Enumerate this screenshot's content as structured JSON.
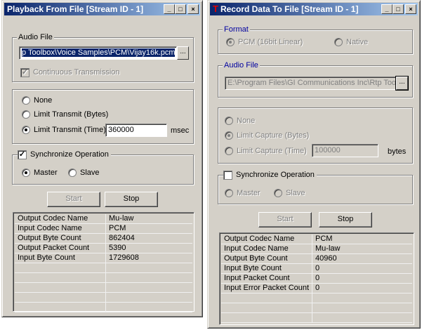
{
  "playback": {
    "title": "Playback From File [Stream ID - 1]",
    "audio_file_legend": "Audio File",
    "file_path": "p Toolbox\\Voice Samples\\PCM\\Vijay16k.pcm",
    "browse_label": "...",
    "continuous_label": "Continuous Transmission",
    "limit_none": "None",
    "limit_bytes": "Limit Transmit (Bytes)",
    "limit_time": "Limit Transmit (Time)",
    "limit_value": "360000",
    "limit_unit": "msec",
    "sync_label": "Synchronize Operation",
    "master_label": "Master",
    "slave_label": "Slave",
    "start_label": "Start",
    "stop_label": "Stop",
    "rows": [
      {
        "name": "Output Codec Name",
        "value": "Mu-law"
      },
      {
        "name": "Input Codec Name",
        "value": "PCM"
      },
      {
        "name": "Output Byte Count",
        "value": "862404"
      },
      {
        "name": "Output Packet Count",
        "value": "5390"
      },
      {
        "name": "Input Byte Count",
        "value": "1729608"
      },
      {
        "name": "",
        "value": ""
      },
      {
        "name": "",
        "value": ""
      },
      {
        "name": "",
        "value": ""
      },
      {
        "name": "",
        "value": ""
      },
      {
        "name": "",
        "value": ""
      }
    ]
  },
  "record": {
    "title_icon": "T",
    "title": "Record Data To File [Stream ID - 1]",
    "format_legend": "Format",
    "pcm_label": "PCM (16bit Linear)",
    "native_label": "Native",
    "audio_file_legend": "Audio File",
    "file_path": "E:\\Program Files\\GI Communications Inc\\Rtp Too",
    "browse_label": "...",
    "limit_none": "None",
    "limit_bytes": "Limit Capture (Bytes)",
    "limit_time": "Limit Capture (Time)",
    "limit_value": "100000",
    "limit_unit": "bytes",
    "sync_label": "Synchronize Operation",
    "master_label": "Master",
    "slave_label": "Slave",
    "start_label": "Start",
    "stop_label": "Stop",
    "rows": [
      {
        "name": "Output Codec Name",
        "value": "PCM"
      },
      {
        "name": "Input Codec Name",
        "value": "Mu-law"
      },
      {
        "name": "Output Byte Count",
        "value": "40960"
      },
      {
        "name": "Input Byte Count",
        "value": "0"
      },
      {
        "name": "Input Packet Count",
        "value": "0"
      },
      {
        "name": "Input Error Packet Count",
        "value": "0"
      },
      {
        "name": "",
        "value": ""
      },
      {
        "name": "",
        "value": ""
      },
      {
        "name": "",
        "value": ""
      }
    ]
  },
  "titlebar_buttons": {
    "minimize": "_",
    "maximize": "□",
    "close": "×"
  },
  "check_mark": "✓"
}
